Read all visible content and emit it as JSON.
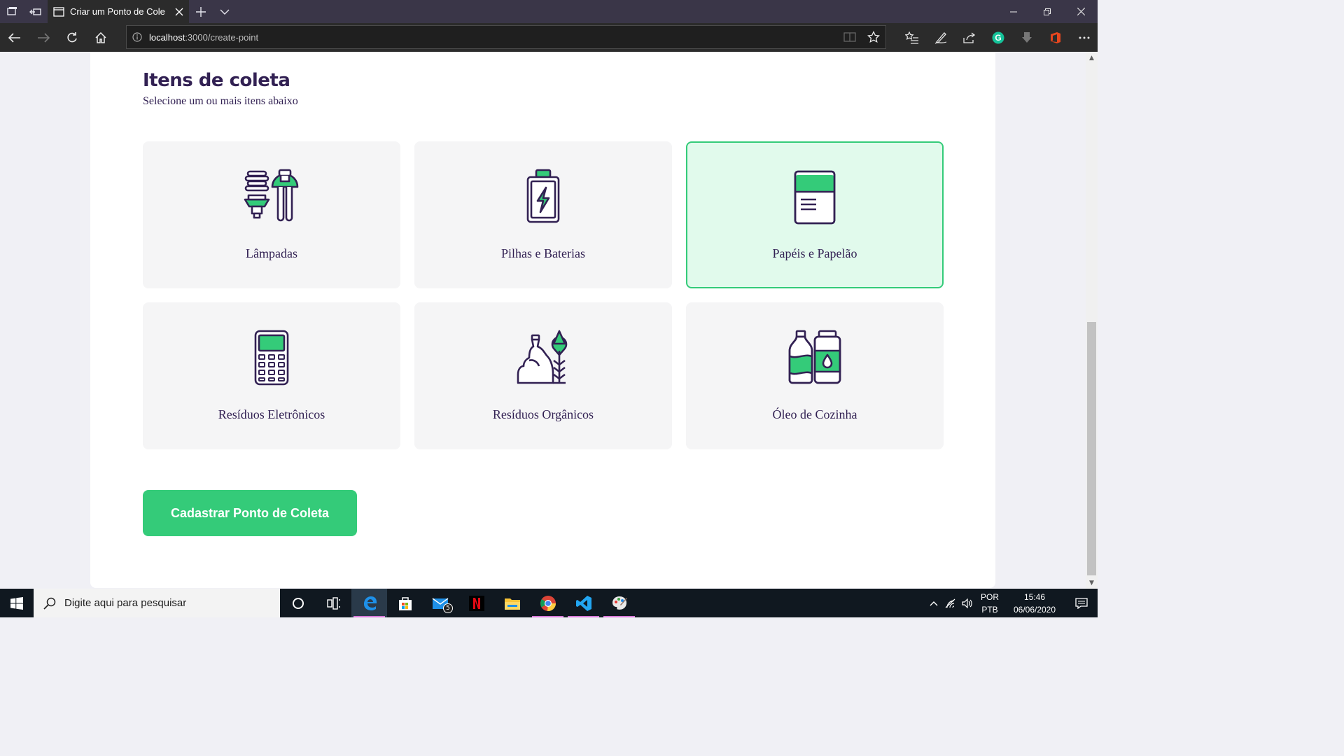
{
  "browser": {
    "tab_title": "Criar um Ponto de Cole",
    "url_host": "localhost",
    "url_path": ":3000/create-point"
  },
  "page": {
    "title": "Itens de coleta",
    "subtitle": "Selecione um ou mais itens abaixo",
    "items": [
      {
        "label": "Lâmpadas",
        "icon": "lamps-icon",
        "selected": false
      },
      {
        "label": "Pilhas e Baterias",
        "icon": "battery-icon",
        "selected": false
      },
      {
        "label": "Papéis e Papelão",
        "icon": "paper-icon",
        "selected": true
      },
      {
        "label": "Resíduos Eletrônicos",
        "icon": "electronics-icon",
        "selected": false
      },
      {
        "label": "Resíduos Orgânicos",
        "icon": "organic-icon",
        "selected": false
      },
      {
        "label": "Óleo de Cozinha",
        "icon": "oil-icon",
        "selected": false
      }
    ],
    "submit_label": "Cadastrar Ponto de Coleta"
  },
  "taskbar": {
    "search_placeholder": "Digite aqui para pesquisar",
    "mail_badge": "5",
    "lang_top": "POR",
    "lang_bottom": "PTB",
    "time": "15:46",
    "date": "06/06/2020"
  },
  "colors": {
    "brand_green": "#34cb79",
    "selected_bg": "#e1faec",
    "title_purple": "#322153"
  }
}
